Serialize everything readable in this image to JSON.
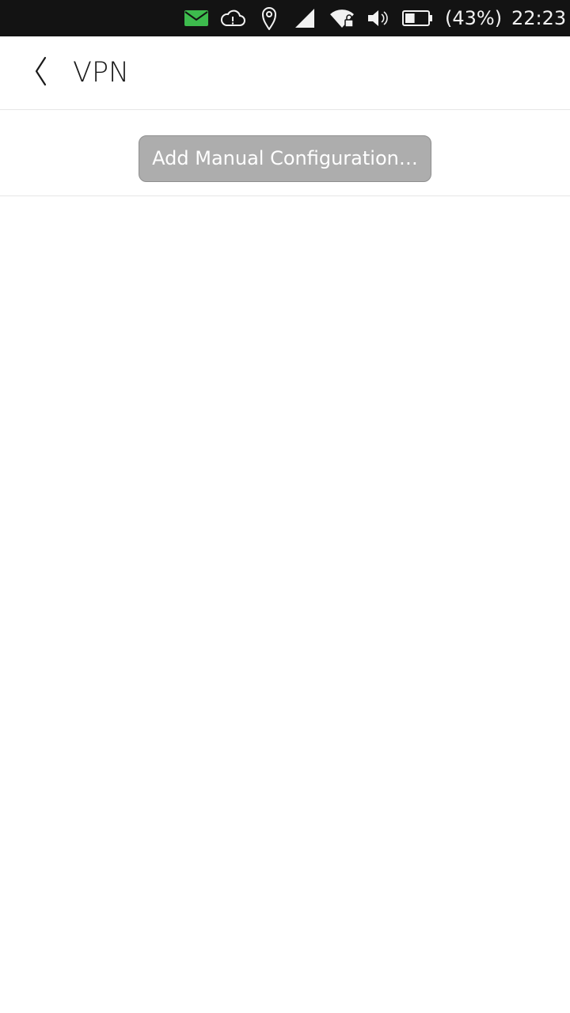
{
  "status_bar": {
    "icons": [
      "mail-icon",
      "cloud-alert-icon",
      "location-icon",
      "cellular-signal-icon",
      "wifi-locked-icon",
      "volume-icon",
      "battery-icon"
    ],
    "battery_percent": "(43%)",
    "time": "22:23",
    "colors": {
      "background": "#131313",
      "mail": "#3dbb4d",
      "icons": "#f2f2f2"
    }
  },
  "header": {
    "title": "VPN"
  },
  "actions": {
    "add_manual_label": "Add Manual Configuration…"
  }
}
